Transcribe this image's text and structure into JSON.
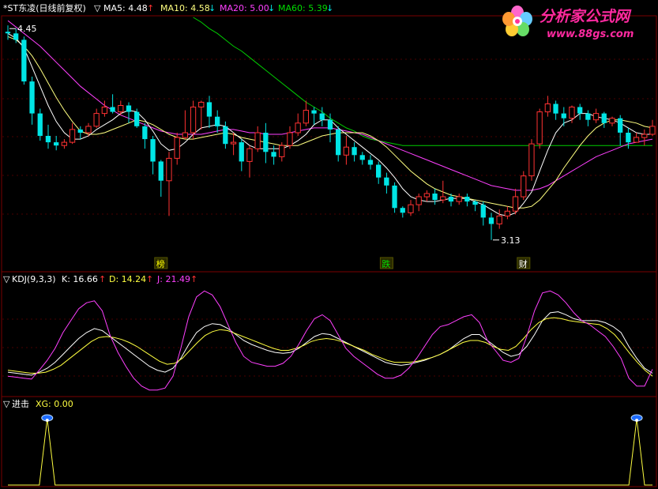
{
  "colors": {
    "up": "#ff3232",
    "down": "#00e5e5",
    "ma5": "#ffffff",
    "ma10": "#ffff80",
    "ma20": "#ff40ff",
    "ma60": "#00cc00",
    "grid": "#7a0000",
    "dash": "#4a0000",
    "kline": "#ffffff",
    "dline": "#ffff40",
    "jline": "#ff40ff",
    "xg": "#ffff40",
    "label_white": "#ffffff",
    "label_red": "#ff3232",
    "label_yellow": "#ffff00",
    "label_magenta": "#ff40ff",
    "label_green": "#00dd00"
  },
  "header": {
    "title": "*ST东凌(日线前复权)",
    "tri": "▽",
    "ma5_label": "MA5: 4.48",
    "ma10_label": "MA10: 4.58",
    "ma20_label": "MA20: 5.00",
    "ma60_label": "MA60: 5.39",
    "up_arrow": "↑",
    "down_arrow": "↓"
  },
  "kdj_header": {
    "title": "KDJ(9,3,3)",
    "k": "K: 16.66",
    "d": "D: 14.24",
    "j": "J: 21.49"
  },
  "xg_header": {
    "title": "进击",
    "xg": "XG: 0.00"
  },
  "watermark": {
    "text": "分析家公式网",
    "url": "www.88gs.com"
  },
  "annotations": {
    "high": "4.45",
    "low": "3.13",
    "tags": [
      "榜",
      "跌",
      "财"
    ]
  },
  "chart_data": [
    {
      "type": "candlestick",
      "title": "*ST东凌(日线前复权)",
      "ylim": [
        3.05,
        4.52
      ],
      "candles": [
        [
          4.43,
          4.42,
          4.47,
          4.38
        ],
        [
          4.42,
          4.38,
          4.45,
          4.36
        ],
        [
          4.38,
          4.12,
          4.4,
          4.1
        ],
        [
          4.12,
          3.92,
          4.15,
          3.85
        ],
        [
          3.92,
          3.78,
          3.95,
          3.75
        ],
        [
          3.78,
          3.74,
          3.85,
          3.7
        ],
        [
          3.74,
          3.72,
          3.78,
          3.69
        ],
        [
          3.72,
          3.74,
          3.76,
          3.7
        ],
        [
          3.74,
          3.82,
          3.86,
          3.73
        ],
        [
          3.82,
          3.8,
          3.84,
          3.76
        ],
        [
          3.8,
          3.84,
          3.86,
          3.78
        ],
        [
          3.84,
          3.92,
          3.95,
          3.83
        ],
        [
          3.92,
          3.96,
          4.0,
          3.9
        ],
        [
          3.96,
          3.93,
          4.04,
          3.92
        ],
        [
          3.93,
          3.97,
          4.0,
          3.91
        ],
        [
          3.97,
          3.93,
          3.99,
          3.86
        ],
        [
          3.93,
          3.84,
          3.95,
          3.83
        ],
        [
          3.84,
          3.76,
          3.86,
          3.7
        ],
        [
          3.76,
          3.62,
          3.78,
          3.54
        ],
        [
          3.62,
          3.5,
          3.63,
          3.4
        ],
        [
          3.5,
          3.64,
          3.68,
          3.28
        ],
        [
          3.64,
          3.77,
          3.8,
          3.6
        ],
        [
          3.77,
          3.8,
          3.94,
          3.76
        ],
        [
          3.8,
          3.96,
          4.0,
          3.76
        ],
        [
          3.96,
          3.99,
          4.0,
          3.82
        ],
        [
          3.99,
          3.9,
          4.03,
          3.83
        ],
        [
          3.9,
          3.84,
          3.94,
          3.8
        ],
        [
          3.84,
          3.73,
          3.87,
          3.7
        ],
        [
          3.73,
          3.74,
          3.8,
          3.66
        ],
        [
          3.74,
          3.62,
          3.76,
          3.56
        ],
        [
          3.62,
          3.7,
          3.72,
          3.52
        ],
        [
          3.7,
          3.8,
          3.84,
          3.68
        ],
        [
          3.8,
          3.68,
          3.86,
          3.61
        ],
        [
          3.68,
          3.65,
          3.72,
          3.6
        ],
        [
          3.65,
          3.72,
          3.74,
          3.62
        ],
        [
          3.72,
          3.8,
          3.84,
          3.7
        ],
        [
          3.8,
          3.86,
          3.92,
          3.78
        ],
        [
          3.86,
          3.94,
          4.0,
          3.84
        ],
        [
          3.94,
          3.92,
          3.96,
          3.85
        ],
        [
          3.92,
          3.88,
          3.96,
          3.84
        ],
        [
          3.88,
          3.82,
          3.92,
          3.74
        ],
        [
          3.82,
          3.66,
          3.84,
          3.62
        ],
        [
          3.66,
          3.71,
          3.78,
          3.6
        ],
        [
          3.71,
          3.66,
          3.74,
          3.62
        ],
        [
          3.66,
          3.63,
          3.68,
          3.6
        ],
        [
          3.63,
          3.6,
          3.66,
          3.57
        ],
        [
          3.6,
          3.52,
          3.62,
          3.48
        ],
        [
          3.52,
          3.47,
          3.55,
          3.42
        ],
        [
          3.47,
          3.33,
          3.49,
          3.3
        ],
        [
          3.33,
          3.3,
          3.34,
          3.27
        ],
        [
          3.3,
          3.35,
          3.38,
          3.28
        ],
        [
          3.35,
          3.4,
          3.42,
          3.31
        ],
        [
          3.4,
          3.42,
          3.44,
          3.37
        ],
        [
          3.42,
          3.38,
          3.45,
          3.35
        ],
        [
          3.38,
          3.4,
          3.5,
          3.36
        ],
        [
          3.4,
          3.37,
          3.42,
          3.34
        ],
        [
          3.37,
          3.4,
          3.42,
          3.35
        ],
        [
          3.4,
          3.37,
          3.42,
          3.34
        ],
        [
          3.37,
          3.35,
          3.38,
          3.31
        ],
        [
          3.35,
          3.27,
          3.37,
          3.22
        ],
        [
          3.27,
          3.23,
          3.3,
          3.13
        ],
        [
          3.23,
          3.28,
          3.32,
          3.2
        ],
        [
          3.28,
          3.31,
          3.34,
          3.26
        ],
        [
          3.31,
          3.4,
          3.45,
          3.29
        ],
        [
          3.4,
          3.53,
          3.56,
          3.38
        ],
        [
          3.53,
          3.73,
          3.76,
          3.5
        ],
        [
          3.73,
          3.93,
          3.95,
          3.7
        ],
        [
          3.93,
          3.98,
          4.03,
          3.9
        ],
        [
          3.98,
          3.92,
          4.0,
          3.88
        ],
        [
          3.92,
          3.89,
          3.96,
          3.84
        ],
        [
          3.89,
          3.96,
          3.97,
          3.86
        ],
        [
          3.96,
          3.92,
          3.98,
          3.88
        ],
        [
          3.92,
          3.88,
          3.94,
          3.84
        ],
        [
          3.88,
          3.92,
          3.95,
          3.86
        ],
        [
          3.92,
          3.86,
          3.93,
          3.83
        ],
        [
          3.86,
          3.89,
          3.9,
          3.84
        ],
        [
          3.89,
          3.8,
          3.91,
          3.72
        ],
        [
          3.8,
          3.74,
          3.83,
          3.7
        ],
        [
          3.74,
          3.77,
          3.8,
          3.74
        ],
        [
          3.77,
          3.79,
          3.82,
          3.72
        ],
        [
          3.79,
          3.84,
          3.88,
          3.78
        ]
      ],
      "ma5": [
        4.42,
        4.39,
        4.33,
        4.21,
        4.09,
        3.97,
        3.87,
        3.8,
        3.76,
        3.76,
        3.78,
        3.82,
        3.85,
        3.88,
        3.92,
        3.94,
        3.93,
        3.88,
        3.81,
        3.73,
        3.69,
        3.7,
        3.74,
        3.79,
        3.83,
        3.84,
        3.85,
        3.84,
        3.8,
        3.76,
        3.72,
        3.7,
        3.7,
        3.7,
        3.7,
        3.72,
        3.75,
        3.79,
        3.85,
        3.88,
        3.88,
        3.83,
        3.79,
        3.75,
        3.71,
        3.67,
        3.63,
        3.58,
        3.52,
        3.45,
        3.4,
        3.38,
        3.37,
        3.37,
        3.38,
        3.39,
        3.39,
        3.39,
        3.37,
        3.35,
        3.32,
        3.29,
        3.28,
        3.3,
        3.36,
        3.43,
        3.56,
        3.69,
        3.8,
        3.86,
        3.88,
        3.92,
        3.92,
        3.9,
        3.89,
        3.88,
        3.86,
        3.83,
        3.8,
        3.79,
        3.79
      ],
      "ma10": [
        4.4,
        4.38,
        4.34,
        4.28,
        4.2,
        4.11,
        4.02,
        3.94,
        3.87,
        3.81,
        3.79,
        3.79,
        3.8,
        3.82,
        3.84,
        3.86,
        3.88,
        3.87,
        3.85,
        3.82,
        3.79,
        3.77,
        3.76,
        3.76,
        3.77,
        3.78,
        3.79,
        3.8,
        3.79,
        3.77,
        3.76,
        3.75,
        3.74,
        3.73,
        3.72,
        3.72,
        3.72,
        3.74,
        3.76,
        3.78,
        3.79,
        3.8,
        3.8,
        3.8,
        3.8,
        3.78,
        3.75,
        3.71,
        3.66,
        3.61,
        3.56,
        3.52,
        3.48,
        3.45,
        3.43,
        3.41,
        3.4,
        3.39,
        3.38,
        3.37,
        3.36,
        3.35,
        3.34,
        3.33,
        3.33,
        3.34,
        3.38,
        3.44,
        3.5,
        3.58,
        3.65,
        3.72,
        3.78,
        3.83,
        3.86,
        3.88,
        3.88,
        3.87,
        3.86,
        3.84,
        3.83
      ],
      "ma20": [
        4.5,
        4.46,
        4.42,
        4.38,
        4.34,
        4.29,
        4.24,
        4.19,
        4.14,
        4.09,
        4.05,
        4.01,
        3.97,
        3.94,
        3.91,
        3.89,
        3.87,
        3.85,
        3.83,
        3.81,
        3.8,
        3.79,
        3.79,
        3.79,
        3.79,
        3.8,
        3.81,
        3.82,
        3.82,
        3.81,
        3.8,
        3.8,
        3.79,
        3.79,
        3.79,
        3.8,
        3.81,
        3.82,
        3.83,
        3.83,
        3.83,
        3.82,
        3.81,
        3.8,
        3.79,
        3.77,
        3.75,
        3.73,
        3.71,
        3.69,
        3.67,
        3.65,
        3.63,
        3.61,
        3.59,
        3.57,
        3.55,
        3.53,
        3.51,
        3.49,
        3.47,
        3.46,
        3.45,
        3.44,
        3.44,
        3.44,
        3.45,
        3.47,
        3.5,
        3.53,
        3.56,
        3.59,
        3.62,
        3.65,
        3.67,
        3.69,
        3.71,
        3.73,
        3.74,
        3.75,
        3.76
      ],
      "ma60_segment": {
        "start_index": 23,
        "values": [
          4.52,
          4.49,
          4.45,
          4.42,
          4.38,
          4.34,
          4.31,
          4.27,
          4.23,
          4.19,
          4.15,
          4.11,
          4.07,
          4.03,
          3.99,
          3.96,
          3.93,
          3.89,
          3.86,
          3.83,
          3.81,
          3.78,
          3.76,
          3.75,
          3.74,
          3.73,
          3.72,
          3.72,
          3.72,
          3.72,
          3.72,
          3.72,
          3.72,
          3.72,
          3.72,
          3.72,
          3.72,
          3.72,
          3.72,
          3.72,
          3.72,
          3.72,
          3.72,
          3.72,
          3.72,
          3.72,
          3.72,
          3.72,
          3.72,
          3.72,
          3.72,
          3.72,
          3.72,
          3.72,
          3.72,
          3.72,
          3.72,
          3.72
        ]
      },
      "markers": [
        {
          "index": 0,
          "label": "4.45",
          "price": 4.45
        },
        {
          "index": 60,
          "label": "3.13",
          "price": 3.13
        }
      ],
      "tags": [
        {
          "index": 19,
          "text": "榜"
        },
        {
          "index": 47,
          "text": "跌"
        },
        {
          "index": 64,
          "text": "财"
        }
      ]
    },
    {
      "type": "line",
      "title": "KDJ(9,3,3)",
      "ylim": [
        -5,
        105
      ],
      "series": [
        {
          "name": "K",
          "values": [
            18,
            17,
            16,
            15,
            18,
            22,
            28,
            36,
            44,
            52,
            58,
            62,
            60,
            54,
            48,
            42,
            36,
            30,
            24,
            20,
            18,
            22,
            32,
            46,
            58,
            64,
            67,
            66,
            62,
            56,
            50,
            46,
            43,
            40,
            38,
            37,
            38,
            42,
            48,
            54,
            57,
            56,
            52,
            48,
            44,
            40,
            36,
            32,
            28,
            26,
            25,
            26,
            28,
            30,
            33,
            36,
            40,
            46,
            52,
            56,
            56,
            50,
            44,
            38,
            34,
            36,
            44,
            56,
            70,
            78,
            79,
            76,
            72,
            70,
            70,
            70,
            68,
            64,
            58,
            44,
            32,
            22,
            17
          ]
        },
        {
          "name": "D",
          "values": [
            20,
            19,
            18,
            17,
            17,
            18,
            21,
            25,
            31,
            37,
            43,
            49,
            53,
            54,
            53,
            51,
            48,
            44,
            39,
            34,
            29,
            26,
            27,
            32,
            40,
            48,
            55,
            59,
            61,
            60,
            57,
            54,
            51,
            48,
            45,
            42,
            40,
            40,
            42,
            45,
            49,
            51,
            52,
            51,
            49,
            46,
            43,
            40,
            36,
            33,
            30,
            28,
            28,
            28,
            29,
            31,
            33,
            36,
            40,
            44,
            48,
            50,
            50,
            48,
            44,
            41,
            40,
            44,
            52,
            61,
            68,
            72,
            73,
            72,
            70,
            69,
            68,
            67,
            66,
            62,
            56,
            47,
            37,
            28,
            20,
            14
          ]
        },
        {
          "name": "J",
          "values": [
            14,
            13,
            12,
            11,
            20,
            30,
            42,
            58,
            70,
            82,
            88,
            90,
            80,
            55,
            38,
            24,
            12,
            4,
            0,
            0,
            2,
            14,
            42,
            74,
            94,
            100,
            96,
            84,
            66,
            48,
            34,
            28,
            26,
            24,
            24,
            27,
            34,
            46,
            60,
            72,
            76,
            70,
            56,
            42,
            34,
            28,
            22,
            16,
            12,
            12,
            15,
            22,
            32,
            44,
            56,
            64,
            66,
            70,
            74,
            76,
            68,
            50,
            40,
            30,
            28,
            32,
            54,
            80,
            98,
            100,
            96,
            88,
            78,
            70,
            66,
            60,
            54,
            44,
            32,
            12,
            4,
            4,
            21
          ]
        }
      ]
    },
    {
      "type": "line",
      "title": "进击",
      "series": [
        {
          "name": "XG",
          "values": [
            0,
            0,
            0,
            0,
            0,
            1,
            0,
            0,
            0,
            0,
            0,
            0,
            0,
            0,
            0,
            0,
            0,
            0,
            0,
            0,
            0,
            0,
            0,
            0,
            0,
            0,
            0,
            0,
            0,
            0,
            0,
            0,
            0,
            0,
            0,
            0,
            0,
            0,
            0,
            0,
            0,
            0,
            0,
            0,
            0,
            0,
            0,
            0,
            0,
            0,
            0,
            0,
            0,
            0,
            0,
            0,
            0,
            0,
            0,
            0,
            0,
            0,
            0,
            0,
            0,
            0,
            0,
            0,
            0,
            0,
            0,
            0,
            0,
            0,
            0,
            0,
            0,
            0,
            0,
            0,
            1,
            0,
            0
          ]
        }
      ],
      "signal_indices": [
        5,
        59,
        91
      ]
    }
  ]
}
